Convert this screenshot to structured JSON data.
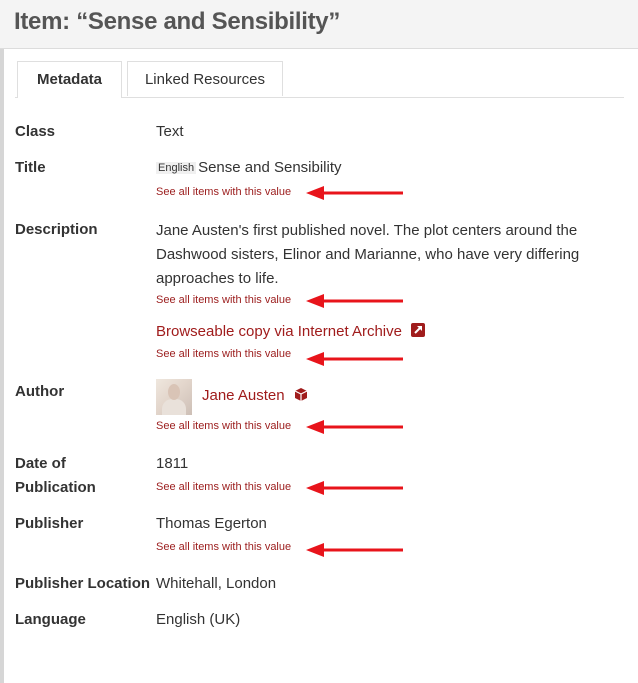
{
  "page": {
    "title": "Item: “Sense and Sensibility”"
  },
  "tabs": [
    {
      "label": "Metadata",
      "active": true
    },
    {
      "label": "Linked Resources",
      "active": false
    }
  ],
  "see_all_label": "See all items with this value",
  "metadata": {
    "class": {
      "label": "Class",
      "value": "Text"
    },
    "title": {
      "label": "Title",
      "lang": "English",
      "value": "Sense and Sensibility"
    },
    "description": {
      "label": "Description",
      "value": "Jane Austen's first published novel. The plot centers around the Dashwood sisters, Elinor and Marianne, who have very differing approaches to life.",
      "link_text": "Browseable copy via Internet Archive",
      "link_icon": "external-link-icon"
    },
    "author": {
      "label": "Author",
      "value": "Jane Austen",
      "icon": "cube-icon"
    },
    "date": {
      "label_line1": "Date of",
      "label_line2": "Publication",
      "value": "1811"
    },
    "publisher": {
      "label": "Publisher",
      "value": "Thomas Egerton"
    },
    "publisher_location": {
      "label": "Publisher Location",
      "value": "Whitehall, London"
    },
    "language": {
      "label": "Language",
      "value": "English (UK)"
    }
  },
  "colors": {
    "link": "#a01c1c",
    "arrow": "#e8141b"
  }
}
